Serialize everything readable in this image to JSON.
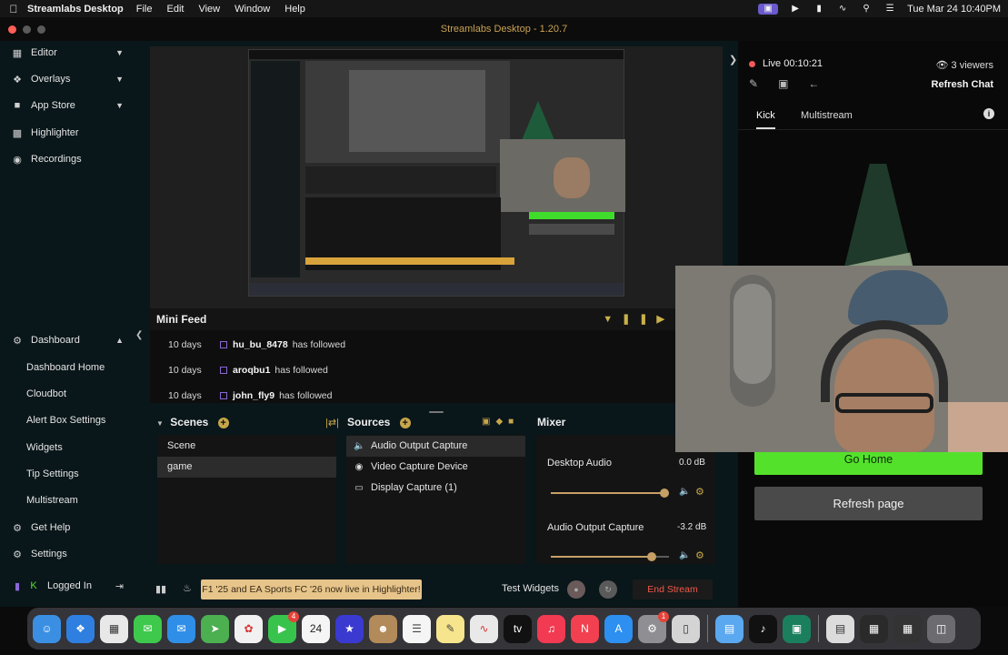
{
  "menubar": {
    "app_name": "Streamlabs Desktop",
    "menus": [
      "File",
      "Edit",
      "View",
      "Window",
      "Help"
    ],
    "datetime": "Tue Mar 24  10:40PM"
  },
  "window": {
    "title": "Streamlabs Desktop - 1.20.7"
  },
  "sidebar": {
    "items": [
      {
        "label": "Editor",
        "icon": "editor-icon",
        "expandable": true
      },
      {
        "label": "Overlays",
        "icon": "overlays-icon",
        "expandable": true
      },
      {
        "label": "App Store",
        "icon": "app-store-icon",
        "expandable": true
      },
      {
        "label": "Highlighter",
        "icon": "highlighter-icon"
      },
      {
        "label": "Recordings",
        "icon": "recordings-icon"
      }
    ],
    "dashboard": {
      "label": "Dashboard",
      "children": [
        "Dashboard Home",
        "Cloudbot",
        "Alert Box Settings",
        "Widgets",
        "Tip Settings",
        "Multistream"
      ]
    },
    "get_help": "Get Help",
    "settings": "Settings",
    "logged_in": "Logged In"
  },
  "mini_feed": {
    "title": "Mini Feed",
    "rows": [
      {
        "days": "10 days",
        "user": "hu_bu_8478",
        "action": "has followed"
      },
      {
        "days": "10 days",
        "user": "aroqbu1",
        "action": "has followed"
      },
      {
        "days": "10 days",
        "user": "john_fly9",
        "action": "has followed"
      }
    ]
  },
  "scenes": {
    "title": "Scenes",
    "items": [
      "Scene",
      "game"
    ],
    "selected": "game"
  },
  "sources": {
    "title": "Sources",
    "items": [
      {
        "label": "Audio Output Capture",
        "icon": "speaker-icon"
      },
      {
        "label": "Video Capture Device",
        "icon": "camera-icon"
      },
      {
        "label": "Display Capture (1)",
        "icon": "monitor-icon"
      }
    ]
  },
  "mixer": {
    "title": "Mixer",
    "channels": [
      {
        "label": "Desktop Audio",
        "db": "0.0 dB",
        "level": 0.96
      },
      {
        "label": "Audio Output Capture",
        "db": "-3.2 dB",
        "level": 0.85
      }
    ]
  },
  "footer": {
    "notice": "F1 '25 and EA Sports FC '26 now live in Highlighter!",
    "test_widgets": "Test Widgets",
    "end_stream": "End Stream"
  },
  "right_panel": {
    "live": "Live 00:10:21",
    "viewers": "3 viewers",
    "refresh_chat": "Refresh Chat",
    "tabs": [
      "Kick",
      "Multistream"
    ],
    "go_home": "Go Home",
    "refresh_page": "Refresh page"
  },
  "colors": {
    "accent": "#c6a064",
    "go_home": "#54e12c",
    "live": "#f05a5a",
    "end_stream": "#f05a4a"
  }
}
